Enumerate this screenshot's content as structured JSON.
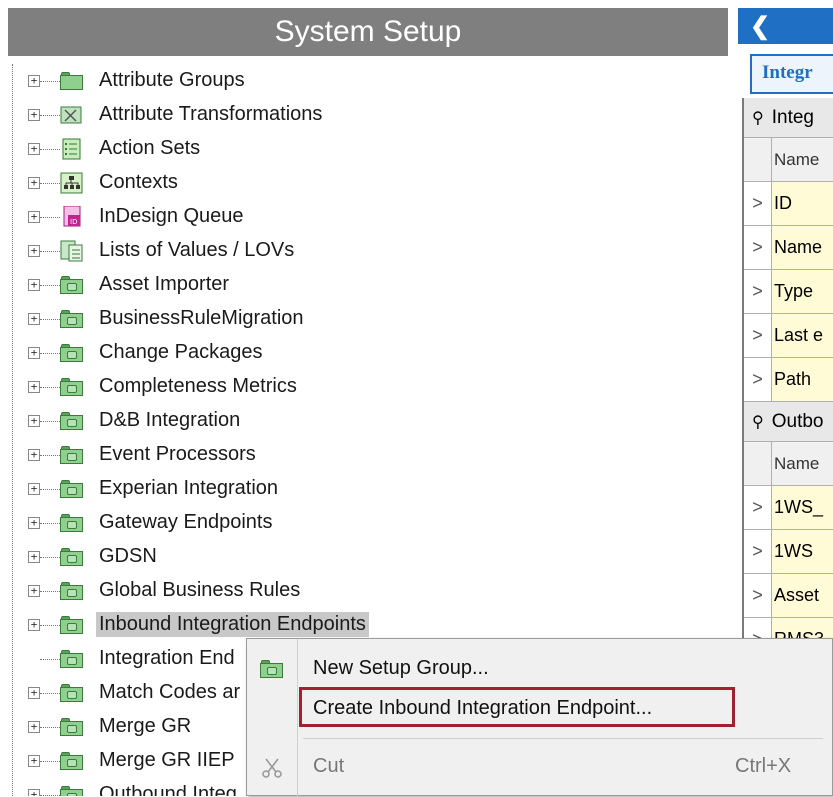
{
  "left_panel": {
    "title": "System Setup",
    "tree": [
      {
        "label": "Attribute Groups",
        "icon": "folder-icon",
        "expandable": true
      },
      {
        "label": "Attribute Transformations",
        "icon": "attribute-transformation-icon",
        "expandable": true
      },
      {
        "label": "Action Sets",
        "icon": "action-set-icon",
        "expandable": true
      },
      {
        "label": "Contexts",
        "icon": "context-hierarchy-icon",
        "expandable": true
      },
      {
        "label": "InDesign Queue",
        "icon": "indesign-queue-icon",
        "expandable": true
      },
      {
        "label": "Lists of Values / LOVs",
        "icon": "list-of-values-icon",
        "expandable": true
      },
      {
        "label": "Asset Importer",
        "icon": "setup-group-folder-icon",
        "expandable": true
      },
      {
        "label": "BusinessRuleMigration",
        "icon": "setup-group-folder-icon",
        "expandable": true
      },
      {
        "label": "Change Packages",
        "icon": "setup-group-folder-icon",
        "expandable": true
      },
      {
        "label": "Completeness Metrics",
        "icon": "setup-group-folder-icon",
        "expandable": true
      },
      {
        "label": "D&B Integration",
        "icon": "setup-group-folder-icon",
        "expandable": true
      },
      {
        "label": "Event Processors",
        "icon": "setup-group-folder-icon",
        "expandable": true
      },
      {
        "label": "Experian Integration",
        "icon": "setup-group-folder-icon",
        "expandable": true
      },
      {
        "label": "Gateway Endpoints",
        "icon": "setup-group-folder-icon",
        "expandable": true
      },
      {
        "label": "GDSN",
        "icon": "setup-group-folder-icon",
        "expandable": true
      },
      {
        "label": "Global Business Rules",
        "icon": "setup-group-folder-icon",
        "expandable": true
      },
      {
        "label": "Inbound Integration Endpoints",
        "icon": "setup-group-folder-icon",
        "expandable": true,
        "selected": true
      },
      {
        "label": "Integration End",
        "icon": "setup-group-folder-icon",
        "expandable": false
      },
      {
        "label": "Match Codes ar",
        "icon": "setup-group-folder-icon",
        "expandable": true
      },
      {
        "label": "Merge GR",
        "icon": "setup-group-folder-icon",
        "expandable": true
      },
      {
        "label": "Merge GR IIEP",
        "icon": "setup-group-folder-icon",
        "expandable": true
      },
      {
        "label": "Outbound Integ",
        "icon": "setup-group-folder-icon",
        "expandable": true
      }
    ]
  },
  "right_panel": {
    "back_icon": "chevron-left-icon",
    "tab_label": "Integr",
    "section1": {
      "title": "Integ",
      "header": "Name",
      "rows": [
        "ID",
        "Name",
        "Type",
        "Last e",
        "Path"
      ]
    },
    "section2": {
      "title": "Outbo",
      "header": "Name",
      "rows": [
        "1WS_",
        "1WS ",
        "Asset",
        "RMS3",
        "=",
        "_"
      ]
    }
  },
  "context_menu": {
    "items": [
      {
        "label": "New Setup Group...",
        "icon": "setup-group-folder-icon",
        "enabled": true
      },
      {
        "label": "Create Inbound Integration Endpoint...",
        "icon": "",
        "enabled": true,
        "highlighted": true
      },
      {
        "label": "Cut",
        "icon": "scissors-icon",
        "enabled": false,
        "shortcut": "Ctrl+X"
      }
    ]
  },
  "colors": {
    "accent_blue": "#1f6fc5",
    "highlight_red": "#a3202f",
    "title_gray": "#7f7f7f"
  }
}
